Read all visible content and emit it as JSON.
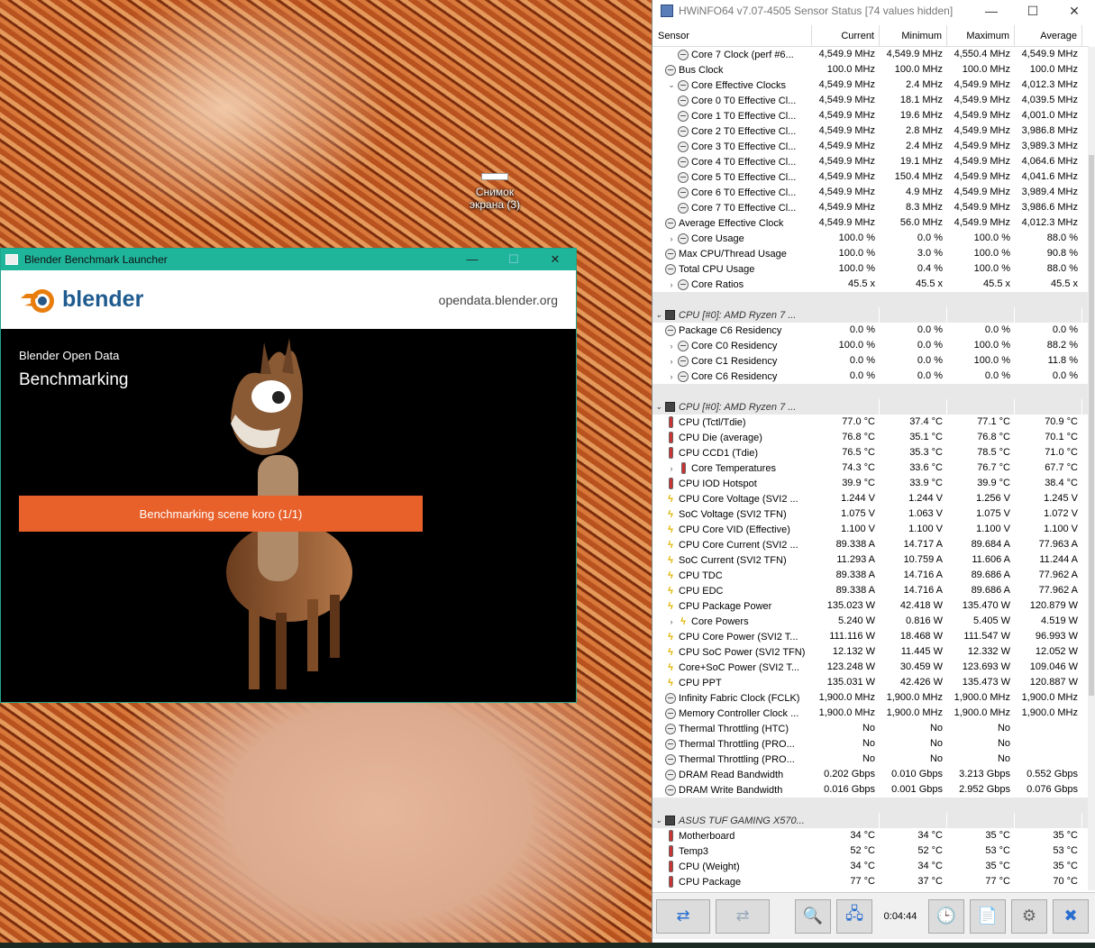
{
  "desktop": {
    "icon_label": "Снимок экрана (3)"
  },
  "blender": {
    "title": "Blender Benchmark Launcher",
    "logo_text": "blender",
    "site": "opendata.blender.org",
    "subtitle": "Blender Open Data",
    "heading": "Benchmarking",
    "progress_label": "Benchmarking scene koro (1/1)",
    "min": "—",
    "max": "☐",
    "close": "✕"
  },
  "hwinfo": {
    "title": "HWiNFO64 v7.07-4505 Sensor Status [74 values hidden]",
    "min": "—",
    "max": "☐",
    "close": "✕",
    "columns": [
      "Sensor",
      "Current",
      "Minimum",
      "Maximum",
      "Average"
    ],
    "timer": "0:04:44",
    "rows": [
      {
        "t": "s",
        "exp": "",
        "ind": 1,
        "icon": "clock",
        "name": "Core 7 Clock (perf #6...",
        "cur": "4,549.9 MHz",
        "min": "4,549.9 MHz",
        "max": "4,550.4 MHz",
        "avg": "4,549.9 MHz"
      },
      {
        "t": "s",
        "exp": "",
        "ind": 0,
        "icon": "clock",
        "name": "Bus Clock",
        "cur": "100.0 MHz",
        "min": "100.0 MHz",
        "max": "100.0 MHz",
        "avg": "100.0 MHz"
      },
      {
        "t": "s",
        "exp": "⌄",
        "ind": 1,
        "icon": "clock",
        "name": "Core Effective Clocks",
        "cur": "4,549.9 MHz",
        "min": "2.4 MHz",
        "max": "4,549.9 MHz",
        "avg": "4,012.3 MHz"
      },
      {
        "t": "s",
        "exp": "",
        "ind": 1,
        "icon": "clock",
        "name": "Core 0 T0 Effective Cl...",
        "cur": "4,549.9 MHz",
        "min": "18.1 MHz",
        "max": "4,549.9 MHz",
        "avg": "4,039.5 MHz"
      },
      {
        "t": "s",
        "exp": "",
        "ind": 1,
        "icon": "clock",
        "name": "Core 1 T0 Effective Cl...",
        "cur": "4,549.9 MHz",
        "min": "19.6 MHz",
        "max": "4,549.9 MHz",
        "avg": "4,001.0 MHz"
      },
      {
        "t": "s",
        "exp": "",
        "ind": 1,
        "icon": "clock",
        "name": "Core 2 T0 Effective Cl...",
        "cur": "4,549.9 MHz",
        "min": "2.8 MHz",
        "max": "4,549.9 MHz",
        "avg": "3,986.8 MHz"
      },
      {
        "t": "s",
        "exp": "",
        "ind": 1,
        "icon": "clock",
        "name": "Core 3 T0 Effective Cl...",
        "cur": "4,549.9 MHz",
        "min": "2.4 MHz",
        "max": "4,549.9 MHz",
        "avg": "3,989.3 MHz"
      },
      {
        "t": "s",
        "exp": "",
        "ind": 1,
        "icon": "clock",
        "name": "Core 4 T0 Effective Cl...",
        "cur": "4,549.9 MHz",
        "min": "19.1 MHz",
        "max": "4,549.9 MHz",
        "avg": "4,064.6 MHz"
      },
      {
        "t": "s",
        "exp": "",
        "ind": 1,
        "icon": "clock",
        "name": "Core 5 T0 Effective Cl...",
        "cur": "4,549.9 MHz",
        "min": "150.4 MHz",
        "max": "4,549.9 MHz",
        "avg": "4,041.6 MHz"
      },
      {
        "t": "s",
        "exp": "",
        "ind": 1,
        "icon": "clock",
        "name": "Core 6 T0 Effective Cl...",
        "cur": "4,549.9 MHz",
        "min": "4.9 MHz",
        "max": "4,549.9 MHz",
        "avg": "3,989.4 MHz"
      },
      {
        "t": "s",
        "exp": "",
        "ind": 1,
        "icon": "clock",
        "name": "Core 7 T0 Effective Cl...",
        "cur": "4,549.9 MHz",
        "min": "8.3 MHz",
        "max": "4,549.9 MHz",
        "avg": "3,986.6 MHz"
      },
      {
        "t": "s",
        "exp": "",
        "ind": 0,
        "icon": "clock",
        "name": "Average Effective Clock",
        "cur": "4,549.9 MHz",
        "min": "56.0 MHz",
        "max": "4,549.9 MHz",
        "avg": "4,012.3 MHz"
      },
      {
        "t": "s",
        "exp": "›",
        "ind": 1,
        "icon": "clock",
        "name": "Core Usage",
        "cur": "100.0 %",
        "min": "0.0 %",
        "max": "100.0 %",
        "avg": "88.0 %"
      },
      {
        "t": "s",
        "exp": "",
        "ind": 0,
        "icon": "clock",
        "name": "Max CPU/Thread Usage",
        "cur": "100.0 %",
        "min": "3.0 %",
        "max": "100.0 %",
        "avg": "90.8 %"
      },
      {
        "t": "s",
        "exp": "",
        "ind": 0,
        "icon": "clock",
        "name": "Total CPU Usage",
        "cur": "100.0 %",
        "min": "0.4 %",
        "max": "100.0 %",
        "avg": "88.0 %"
      },
      {
        "t": "s",
        "exp": "›",
        "ind": 1,
        "icon": "clock",
        "name": "Core Ratios",
        "cur": "45.5 x",
        "min": "45.5 x",
        "max": "45.5 x",
        "avg": "45.5 x"
      },
      {
        "t": "b"
      },
      {
        "t": "g",
        "name": "CPU [#0]: AMD Ryzen 7 ..."
      },
      {
        "t": "s",
        "exp": "",
        "ind": 0,
        "icon": "clock",
        "name": "Package C6 Residency",
        "cur": "0.0 %",
        "min": "0.0 %",
        "max": "0.0 %",
        "avg": "0.0 %"
      },
      {
        "t": "s",
        "exp": "›",
        "ind": 1,
        "icon": "clock",
        "name": "Core C0 Residency",
        "cur": "100.0 %",
        "min": "0.0 %",
        "max": "100.0 %",
        "avg": "88.2 %"
      },
      {
        "t": "s",
        "exp": "›",
        "ind": 1,
        "icon": "clock",
        "name": "Core C1 Residency",
        "cur": "0.0 %",
        "min": "0.0 %",
        "max": "100.0 %",
        "avg": "11.8 %"
      },
      {
        "t": "s",
        "exp": "›",
        "ind": 1,
        "icon": "clock",
        "name": "Core C6 Residency",
        "cur": "0.0 %",
        "min": "0.0 %",
        "max": "0.0 %",
        "avg": "0.0 %"
      },
      {
        "t": "b"
      },
      {
        "t": "g",
        "name": "CPU [#0]: AMD Ryzen 7 ..."
      },
      {
        "t": "s",
        "exp": "",
        "ind": 0,
        "icon": "therm",
        "name": "CPU (Tctl/Tdie)",
        "cur": "77.0 °C",
        "min": "37.4 °C",
        "max": "77.1 °C",
        "avg": "70.9 °C"
      },
      {
        "t": "s",
        "exp": "",
        "ind": 0,
        "icon": "therm",
        "name": "CPU Die (average)",
        "cur": "76.8 °C",
        "min": "35.1 °C",
        "max": "76.8 °C",
        "avg": "70.1 °C"
      },
      {
        "t": "s",
        "exp": "",
        "ind": 0,
        "icon": "therm",
        "name": "CPU CCD1 (Tdie)",
        "cur": "76.5 °C",
        "min": "35.3 °C",
        "max": "78.5 °C",
        "avg": "71.0 °C"
      },
      {
        "t": "s",
        "exp": "›",
        "ind": 1,
        "icon": "therm",
        "name": "Core Temperatures",
        "cur": "74.3 °C",
        "min": "33.6 °C",
        "max": "76.7 °C",
        "avg": "67.7 °C"
      },
      {
        "t": "s",
        "exp": "",
        "ind": 0,
        "icon": "therm",
        "name": "CPU IOD Hotspot",
        "cur": "39.9 °C",
        "min": "33.9 °C",
        "max": "39.9 °C",
        "avg": "38.4 °C"
      },
      {
        "t": "s",
        "exp": "",
        "ind": 0,
        "icon": "volt",
        "name": "CPU Core Voltage (SVI2 ...",
        "cur": "1.244 V",
        "min": "1.244 V",
        "max": "1.256 V",
        "avg": "1.245 V"
      },
      {
        "t": "s",
        "exp": "",
        "ind": 0,
        "icon": "volt",
        "name": "SoC Voltage (SVI2 TFN)",
        "cur": "1.075 V",
        "min": "1.063 V",
        "max": "1.075 V",
        "avg": "1.072 V"
      },
      {
        "t": "s",
        "exp": "",
        "ind": 0,
        "icon": "volt",
        "name": "CPU Core VID (Effective)",
        "cur": "1.100 V",
        "min": "1.100 V",
        "max": "1.100 V",
        "avg": "1.100 V"
      },
      {
        "t": "s",
        "exp": "",
        "ind": 0,
        "icon": "volt",
        "name": "CPU Core Current (SVI2 ...",
        "cur": "89.338 A",
        "min": "14.717 A",
        "max": "89.684 A",
        "avg": "77.963 A"
      },
      {
        "t": "s",
        "exp": "",
        "ind": 0,
        "icon": "volt",
        "name": "SoC Current (SVI2 TFN)",
        "cur": "11.293 A",
        "min": "10.759 A",
        "max": "11.606 A",
        "avg": "11.244 A"
      },
      {
        "t": "s",
        "exp": "",
        "ind": 0,
        "icon": "volt",
        "name": "CPU TDC",
        "cur": "89.338 A",
        "min": "14.716 A",
        "max": "89.686 A",
        "avg": "77.962 A"
      },
      {
        "t": "s",
        "exp": "",
        "ind": 0,
        "icon": "volt",
        "name": "CPU EDC",
        "cur": "89.338 A",
        "min": "14.716 A",
        "max": "89.686 A",
        "avg": "77.962 A"
      },
      {
        "t": "s",
        "exp": "",
        "ind": 0,
        "icon": "volt",
        "name": "CPU Package Power",
        "cur": "135.023 W",
        "min": "42.418 W",
        "max": "135.470 W",
        "avg": "120.879 W"
      },
      {
        "t": "s",
        "exp": "›",
        "ind": 1,
        "icon": "volt",
        "name": "Core Powers",
        "cur": "5.240 W",
        "min": "0.816 W",
        "max": "5.405 W",
        "avg": "4.519 W"
      },
      {
        "t": "s",
        "exp": "",
        "ind": 0,
        "icon": "volt",
        "name": "CPU Core Power (SVI2 T...",
        "cur": "111.116 W",
        "min": "18.468 W",
        "max": "111.547 W",
        "avg": "96.993 W"
      },
      {
        "t": "s",
        "exp": "",
        "ind": 0,
        "icon": "volt",
        "name": "CPU SoC Power (SVI2 TFN)",
        "cur": "12.132 W",
        "min": "11.445 W",
        "max": "12.332 W",
        "avg": "12.052 W"
      },
      {
        "t": "s",
        "exp": "",
        "ind": 0,
        "icon": "volt",
        "name": "Core+SoC Power (SVI2 T...",
        "cur": "123.248 W",
        "min": "30.459 W",
        "max": "123.693 W",
        "avg": "109.046 W"
      },
      {
        "t": "s",
        "exp": "",
        "ind": 0,
        "icon": "volt",
        "name": "CPU PPT",
        "cur": "135.031 W",
        "min": "42.426 W",
        "max": "135.473 W",
        "avg": "120.887 W"
      },
      {
        "t": "s",
        "exp": "",
        "ind": 0,
        "icon": "clock",
        "name": "Infinity Fabric Clock (FCLK)",
        "cur": "1,900.0 MHz",
        "min": "1,900.0 MHz",
        "max": "1,900.0 MHz",
        "avg": "1,900.0 MHz"
      },
      {
        "t": "s",
        "exp": "",
        "ind": 0,
        "icon": "clock",
        "name": "Memory Controller Clock ...",
        "cur": "1,900.0 MHz",
        "min": "1,900.0 MHz",
        "max": "1,900.0 MHz",
        "avg": "1,900.0 MHz"
      },
      {
        "t": "s",
        "exp": "",
        "ind": 0,
        "icon": "clock",
        "name": "Thermal Throttling (HTC)",
        "cur": "No",
        "min": "No",
        "max": "No",
        "avg": ""
      },
      {
        "t": "s",
        "exp": "",
        "ind": 0,
        "icon": "clock",
        "name": "Thermal Throttling (PRO...",
        "cur": "No",
        "min": "No",
        "max": "No",
        "avg": ""
      },
      {
        "t": "s",
        "exp": "",
        "ind": 0,
        "icon": "clock",
        "name": "Thermal Throttling (PRO...",
        "cur": "No",
        "min": "No",
        "max": "No",
        "avg": ""
      },
      {
        "t": "s",
        "exp": "",
        "ind": 0,
        "icon": "clock",
        "name": "DRAM Read Bandwidth",
        "cur": "0.202 Gbps",
        "min": "0.010 Gbps",
        "max": "3.213 Gbps",
        "avg": "0.552 Gbps"
      },
      {
        "t": "s",
        "exp": "",
        "ind": 0,
        "icon": "clock",
        "name": "DRAM Write Bandwidth",
        "cur": "0.016 Gbps",
        "min": "0.001 Gbps",
        "max": "2.952 Gbps",
        "avg": "0.076 Gbps"
      },
      {
        "t": "b"
      },
      {
        "t": "g",
        "name": "ASUS TUF GAMING X570..."
      },
      {
        "t": "s",
        "exp": "",
        "ind": 0,
        "icon": "therm",
        "name": "Motherboard",
        "cur": "34 °C",
        "min": "34 °C",
        "max": "35 °C",
        "avg": "35 °C"
      },
      {
        "t": "s",
        "exp": "",
        "ind": 0,
        "icon": "therm",
        "name": "Temp3",
        "cur": "52 °C",
        "min": "52 °C",
        "max": "53 °C",
        "avg": "53 °C"
      },
      {
        "t": "s",
        "exp": "",
        "ind": 0,
        "icon": "therm",
        "name": "CPU (Weight)",
        "cur": "34 °C",
        "min": "34 °C",
        "max": "35 °C",
        "avg": "35 °C"
      },
      {
        "t": "s",
        "exp": "",
        "ind": 0,
        "icon": "therm",
        "name": "CPU Package",
        "cur": "77 °C",
        "min": "37 °C",
        "max": "77 °C",
        "avg": "70 °C"
      }
    ]
  }
}
